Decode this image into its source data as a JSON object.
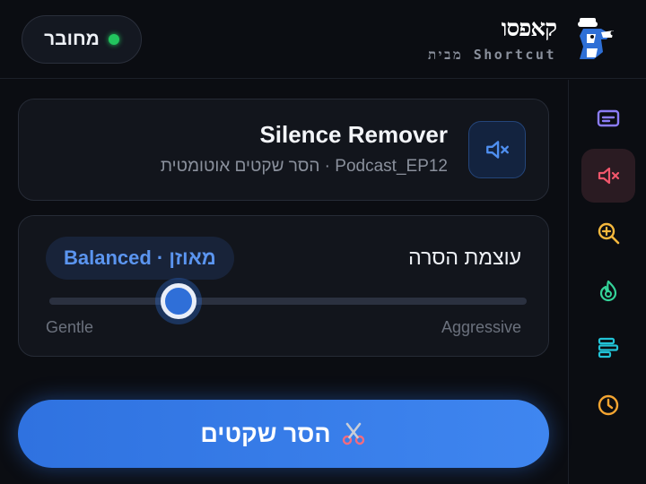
{
  "header": {
    "status_text": "מחובר",
    "brand_logo": "קאפסו",
    "brand_subtitle": "מבית Shortcut"
  },
  "sidebar": {
    "items": [
      {
        "icon": "subtitles-icon",
        "color": "#8b7cf6",
        "active": false
      },
      {
        "icon": "mute-icon",
        "color": "#f0566b",
        "active": true
      },
      {
        "icon": "zoom-in-icon",
        "color": "#f5b83d",
        "active": false
      },
      {
        "icon": "sparkle-icon",
        "color": "#34d399",
        "active": false
      },
      {
        "icon": "layout-bars-icon",
        "color": "#22c3d6",
        "active": false
      },
      {
        "icon": "clock-icon",
        "color": "#f5a531",
        "active": false
      }
    ]
  },
  "tool": {
    "title": "Silence Remover",
    "subtitle": "Podcast_EP12 · הסר שקטים אוטומטית",
    "icon": "mute-icon"
  },
  "intensity": {
    "label": "עוצמת הסרה",
    "badge": "Balanced · מאוזן",
    "value": 0.27,
    "min_label": "Gentle",
    "max_label": "Aggressive"
  },
  "action": {
    "icon": "scissors-icon",
    "label": "הסר שקטים"
  },
  "colors": {
    "accent": "#3f86f0",
    "connected": "#22c55e"
  }
}
